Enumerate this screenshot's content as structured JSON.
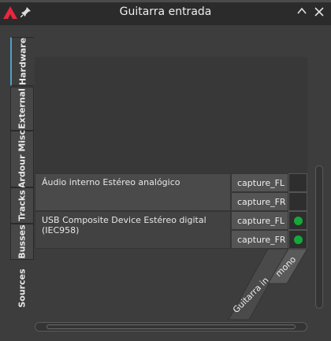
{
  "window": {
    "title": "Guitarra entrada",
    "accent_color": "#e8273f"
  },
  "tabs": [
    {
      "label": "Hardware",
      "active": true
    },
    {
      "label": "External",
      "active": false
    },
    {
      "label": "Ardour Misc",
      "active": false
    },
    {
      "label": "Tracks",
      "active": false
    },
    {
      "label": "Busses",
      "active": false
    },
    {
      "label": "Sources",
      "active": false
    }
  ],
  "rows": [
    {
      "device": "Áudio interno Estéreo analógico",
      "ports": [
        {
          "name": "capture_FL",
          "connected": false
        },
        {
          "name": "capture_FR",
          "connected": false
        }
      ]
    },
    {
      "device": "USB Composite Device Estéreo digital (IEC958)",
      "ports": [
        {
          "name": "capture_FL",
          "connected": true
        },
        {
          "name": "capture_FR",
          "connected": true
        }
      ]
    }
  ],
  "columns": {
    "group": "Guitarra in",
    "port": "mono"
  },
  "status_colors": {
    "connected": "#16a83a"
  }
}
